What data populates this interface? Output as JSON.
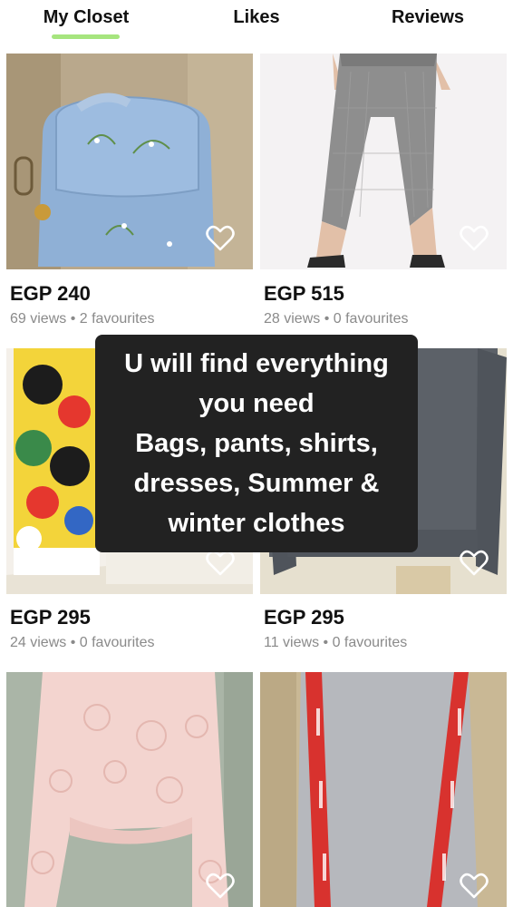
{
  "tabs": [
    {
      "label": "My Closet"
    },
    {
      "label": "Likes"
    },
    {
      "label": "Reviews"
    }
  ],
  "active_tab_color": "#a6e57e",
  "products": [
    {
      "price": "EGP 240",
      "views": "69 views",
      "favourites": "2 favourites",
      "image": "blue-floral-backpack"
    },
    {
      "price": "EGP 515",
      "views": "28 views",
      "favourites": "0 favourites",
      "image": "grey-plaid-trousers"
    },
    {
      "price": "EGP 295",
      "views": "24 views",
      "favourites": "0 favourites",
      "image": "mickey-print-sweatshirt"
    },
    {
      "price": "EGP 295",
      "views": "11 views",
      "favourites": "0 favourites",
      "image": "grey-sweatshirt"
    },
    {
      "price": "",
      "views": "",
      "favourites": "",
      "image": "pink-lace-top"
    },
    {
      "price": "",
      "views": "",
      "favourites": "",
      "image": "grey-dress-red-straps"
    }
  ],
  "separator": "•",
  "overlay": {
    "lines": [
      "U will find everything",
      "you need",
      "Bags, pants, shirts,",
      "dresses, Summer &",
      "winter clothes"
    ]
  },
  "icons": {
    "favourite": "heart-outline-icon"
  }
}
